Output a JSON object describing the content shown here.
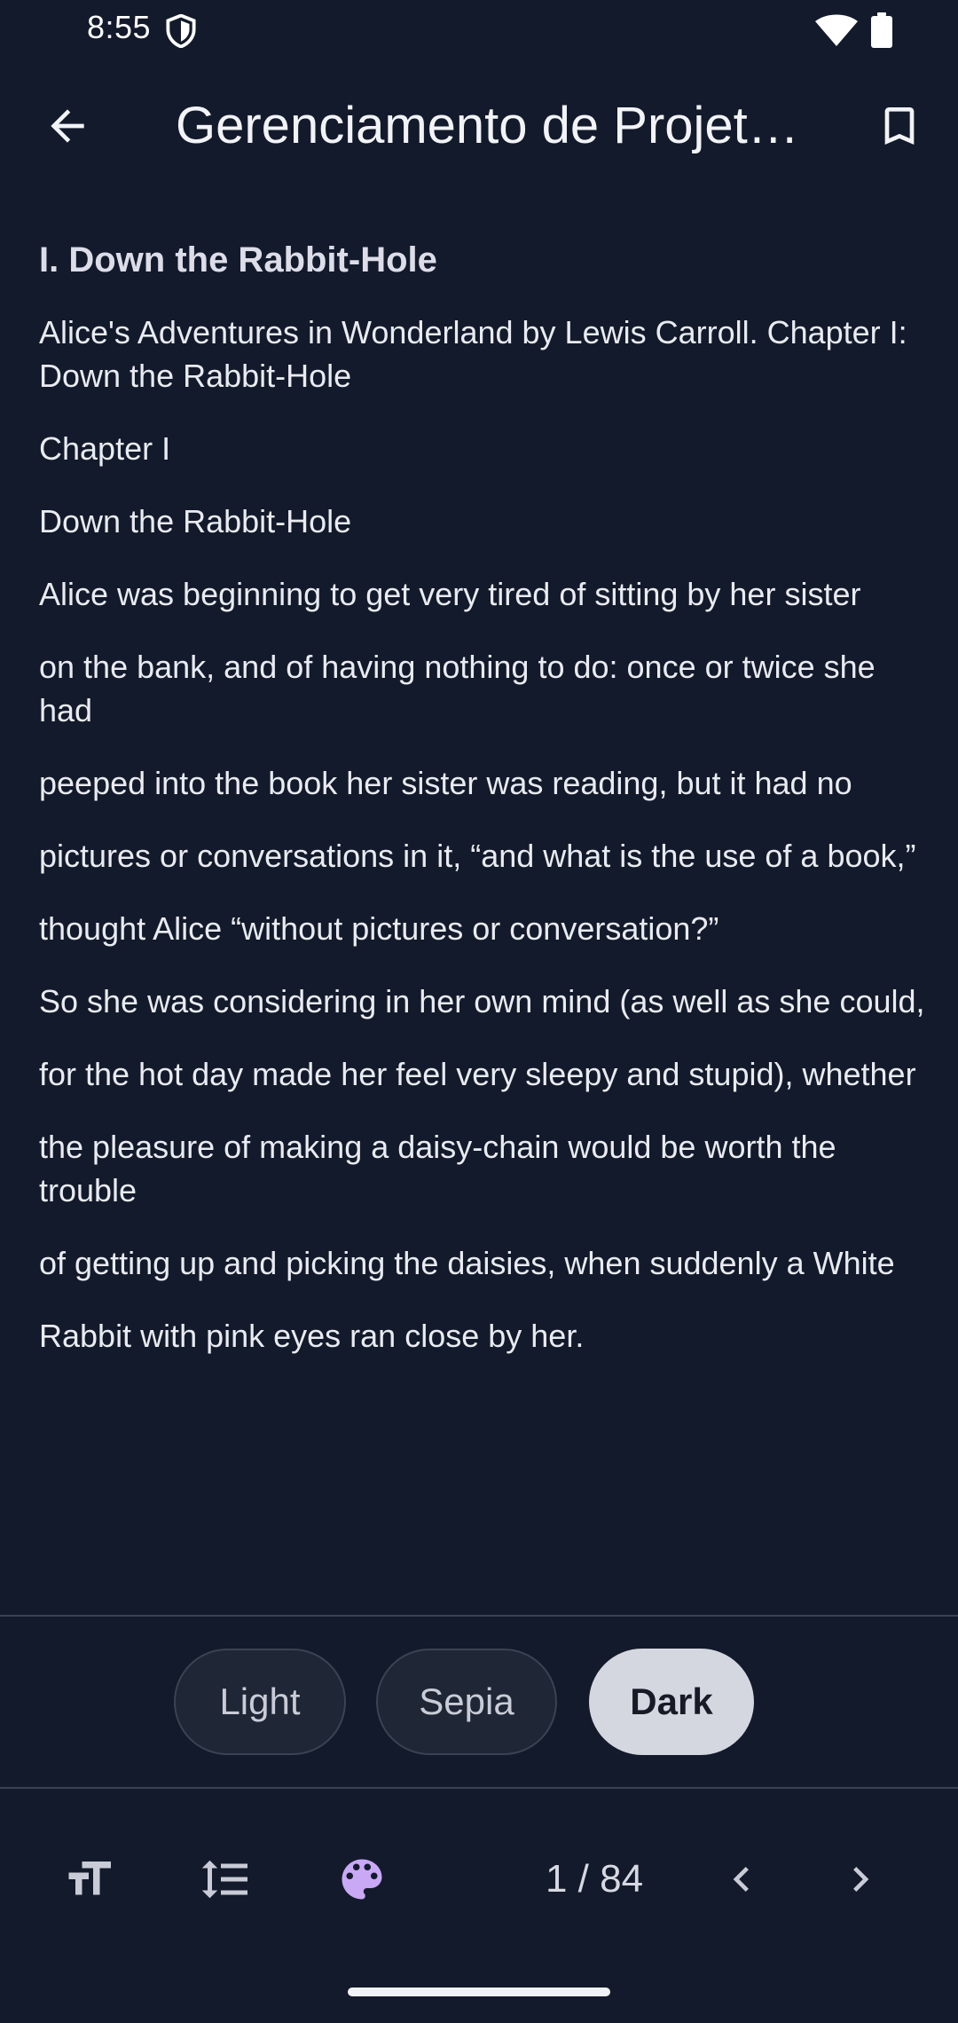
{
  "status_bar": {
    "time": "8:55"
  },
  "app_bar": {
    "title": "Gerenciamento de Projet…"
  },
  "reader": {
    "heading": "I. Down the Rabbit-Hole",
    "paragraphs": [
      "Alice's Adventures in Wonderland by Lewis Carroll. Chapter I: Down the Rabbit-Hole",
      "Chapter I",
      "Down the Rabbit-Hole",
      "Alice was beginning to get very tired of sitting by her sister",
      "on the bank, and of having nothing to do:  once or twice she had",
      "peeped into the book her sister was reading, but it had no",
      "pictures or conversations in it, “and what is the use of a book,”",
      "thought Alice “without pictures or conversation?”",
      "So she was considering in her own mind (as well as she could,",
      "for the hot day made her feel very sleepy and stupid), whether",
      "the pleasure of making a daisy-chain would be worth the trouble",
      "of getting up and picking the daisies, when suddenly a White",
      "Rabbit with pink eyes ran close by her."
    ]
  },
  "themes": {
    "light": "Light",
    "sepia": "Sepia",
    "dark": "Dark",
    "selected": "Dark"
  },
  "toolbar": {
    "page_indicator": "1 / 84",
    "icons": [
      "text-size-icon",
      "line-spacing-icon",
      "palette-icon",
      "chevron-left-icon",
      "chevron-right-icon"
    ]
  },
  "colors": {
    "background": "#131a2b",
    "accent": "#c9a8f5",
    "selected_chip": "#d5d7e0"
  }
}
